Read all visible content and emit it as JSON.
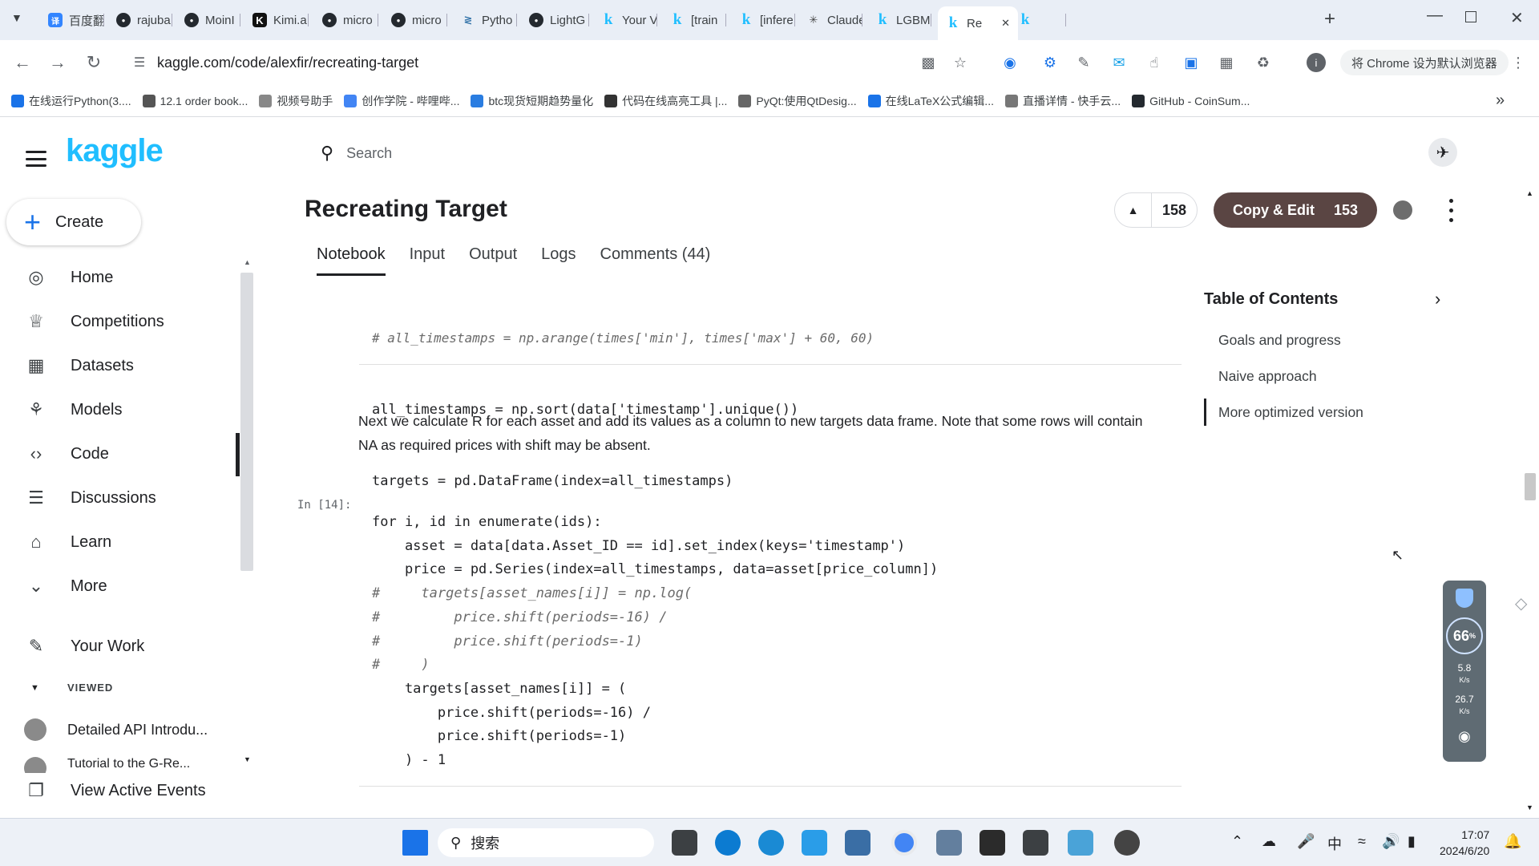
{
  "browser": {
    "tabs": [
      {
        "label": "百度翻",
        "icon": "translate-icon"
      },
      {
        "label": "rajuba",
        "icon": "github-icon"
      },
      {
        "label": "MoinI",
        "icon": "github-icon"
      },
      {
        "label": "Kimi.a",
        "icon": "kimi-icon"
      },
      {
        "label": "micro",
        "icon": "github-icon"
      },
      {
        "label": "micro",
        "icon": "github-icon"
      },
      {
        "label": "Pytho",
        "icon": "python-icon"
      },
      {
        "label": "LightG",
        "icon": "github-icon"
      },
      {
        "label": "Your V",
        "icon": "kaggle-k-icon"
      },
      {
        "label": "[train",
        "icon": "kaggle-k-icon"
      },
      {
        "label": "[infere",
        "icon": "kaggle-k-icon"
      },
      {
        "label": "Claude",
        "icon": "claude-icon"
      },
      {
        "label": "LGBM",
        "icon": "kaggle-k-icon"
      },
      {
        "label": "Re",
        "icon": "kaggle-k-icon",
        "active": true
      },
      {
        "label": "",
        "icon": "kaggle-k-icon"
      }
    ],
    "url": "kaggle.com/code/alexfir/recreating-target",
    "default_browser_label": "将 Chrome 设为默认浏览器",
    "bookmarks": [
      "在线运行Python(3....",
      "12.1 order book...",
      "视频号助手",
      "创作学院 - 哔哩哔...",
      "btc现货短期趋势量化",
      "代码在线高亮工具 |...",
      "PyQt:使用QtDesig...",
      "在线LaTeX公式编辑...",
      "直播详情 - 快手云...",
      "GitHub - CoinSum..."
    ]
  },
  "kaggle": {
    "logo": "kaggle",
    "search_placeholder": "Search",
    "create_label": "Create",
    "nav": [
      {
        "label": "Home",
        "icon": "compass-icon"
      },
      {
        "label": "Competitions",
        "icon": "trophy-icon"
      },
      {
        "label": "Datasets",
        "icon": "table-icon"
      },
      {
        "label": "Models",
        "icon": "models-icon"
      },
      {
        "label": "Code",
        "icon": "code-icon"
      },
      {
        "label": "Discussions",
        "icon": "discussion-icon"
      },
      {
        "label": "Learn",
        "icon": "graduation-cap-icon"
      },
      {
        "label": "More",
        "icon": "chevron-down-icon"
      }
    ],
    "your_work": "Your Work",
    "viewed_label": "VIEWED",
    "viewed_items": [
      "Detailed API Introdu...",
      "Tutorial to the G-Re..."
    ],
    "view_active_events": "View Active Events"
  },
  "notebook": {
    "title": "Recreating Target",
    "votes": "158",
    "copy_edit_label": "Copy & Edit",
    "copy_edit_count": "153",
    "tabs": [
      "Notebook",
      "Input",
      "Output",
      "Logs",
      "Comments (44)"
    ],
    "active_tab": "Notebook",
    "code_top": [
      "# all_timestamps = np.arange(times['min'], times['max'] + 60, 60)",
      "all_timestamps = np.sort(data['timestamp'].unique())",
      "targets = pd.DataFrame(index=all_timestamps)"
    ],
    "markdown": "Next we calculate R for each asset and add its values as a column to new targets data frame. Note that some rows will contain NA as required prices with shift may be absent.",
    "in_label": "In [14]:",
    "code_main": [
      "for i, id in enumerate(ids):",
      "    asset = data[data.Asset_ID == id].set_index(keys='timestamp')",
      "    price = pd.Series(index=all_timestamps, data=asset[price_column])",
      "#     targets[asset_names[i]] = np.log(",
      "#         price.shift(periods=-16) /",
      "#         price.shift(periods=-1)",
      "#     )",
      "    targets[asset_names[i]] = (",
      "        price.shift(periods=-16) /",
      "        price.shift(periods=-1)",
      "    ) - 1"
    ]
  },
  "toc": {
    "title": "Table of Contents",
    "items": [
      "Goals and progress",
      "Naive approach",
      "More optimized version"
    ]
  },
  "widget": {
    "percent": "66",
    "percent_unit": "%",
    "up_speed": "5.8",
    "down_speed": "26.7",
    "speed_unit": "K/s"
  },
  "taskbar": {
    "search_label": "搜索",
    "ime": "中",
    "time": "17:07",
    "date": "2024/6/20"
  }
}
